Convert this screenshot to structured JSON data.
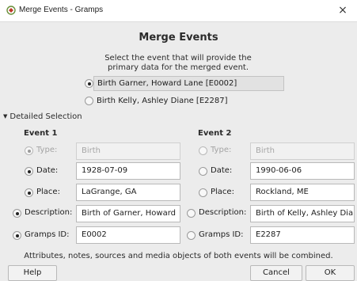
{
  "window": {
    "title": "Merge Events - Gramps",
    "close_glyph": "×"
  },
  "dialog": {
    "heading": "Merge Events",
    "instruction": "Select the event that will provide the primary data for the merged event.",
    "choices": [
      {
        "label": "Birth Garner, Howard Lane [E0002]",
        "selected": true
      },
      {
        "label": "Birth Kelly, Ashley Diane [E2287]",
        "selected": false
      }
    ],
    "expander_label": "Detailed Selection",
    "event1": {
      "header": "Event 1",
      "rows": [
        {
          "label": "Type:",
          "value": "Birth",
          "selected": true,
          "enabled": false
        },
        {
          "label": "Date:",
          "value": "1928-07-09",
          "selected": true,
          "enabled": true
        },
        {
          "label": "Place:",
          "value": "LaGrange, GA",
          "selected": true,
          "enabled": true
        },
        {
          "label": "Description:",
          "value": "Birth of Garner, Howard",
          "selected": true,
          "enabled": true
        },
        {
          "label": "Gramps ID:",
          "value": "E0002",
          "selected": true,
          "enabled": true
        }
      ]
    },
    "event2": {
      "header": "Event 2",
      "rows": [
        {
          "label": "Type:",
          "value": "Birth",
          "selected": false,
          "enabled": false
        },
        {
          "label": "Date:",
          "value": "1990-06-06",
          "selected": false,
          "enabled": true
        },
        {
          "label": "Place:",
          "value": "Rockland, ME",
          "selected": false,
          "enabled": true
        },
        {
          "label": "Description:",
          "value": "Birth of Kelly, Ashley Dia",
          "selected": false,
          "enabled": true
        },
        {
          "label": "Gramps ID:",
          "value": "E2287",
          "selected": false,
          "enabled": true
        }
      ]
    },
    "footer_note": "Attributes, notes, sources and media objects of both events will be combined.",
    "buttons": {
      "help": "Help",
      "cancel": "Cancel",
      "ok": "OK"
    }
  },
  "colors": {
    "window_bg": "#ececec",
    "titlebar_bg": "#ffffff",
    "field_bg": "#ffffff",
    "disabled_text": "#a6a6a6"
  }
}
